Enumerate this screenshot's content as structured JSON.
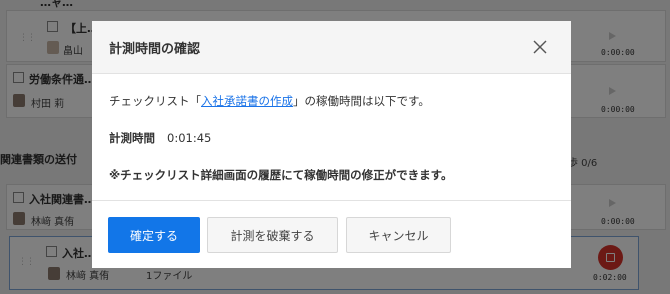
{
  "background": {
    "section_overdue": "…ャ…",
    "top_task": {
      "title": "【上…",
      "person": "畠山"
    },
    "tasks": [
      {
        "title": "労働条件通…",
        "person": "村田 莉"
      },
      {
        "title": "入社関連書…",
        "person": "林﨑 真侑"
      },
      {
        "title": "入社…",
        "person": "林﨑 真侑",
        "attachment": "1ファイル"
      }
    ],
    "section_title": "関連書類の送付",
    "progress": "歩 0/6",
    "timers": [
      "0:00:00",
      "0:00:00",
      "0:00:00",
      "0:02:00"
    ]
  },
  "modal": {
    "title": "計測時間の確認",
    "close_icon": "close-icon",
    "text_prefix": "チェックリスト「",
    "link_text": "入社承諾書の作成",
    "text_suffix": "」の稼働時間は以下です。",
    "measured_label": "計測時間",
    "measured_value": "0:01:45",
    "note": "※チェックリスト詳細画面の履歴にて稼働時間の修正ができます。",
    "buttons": {
      "confirm": "確定する",
      "discard": "計測を破棄する",
      "cancel": "キャンセル"
    }
  },
  "colors": {
    "primary": "#1276e8",
    "link": "#1a73e8",
    "record": "#d9332b"
  }
}
